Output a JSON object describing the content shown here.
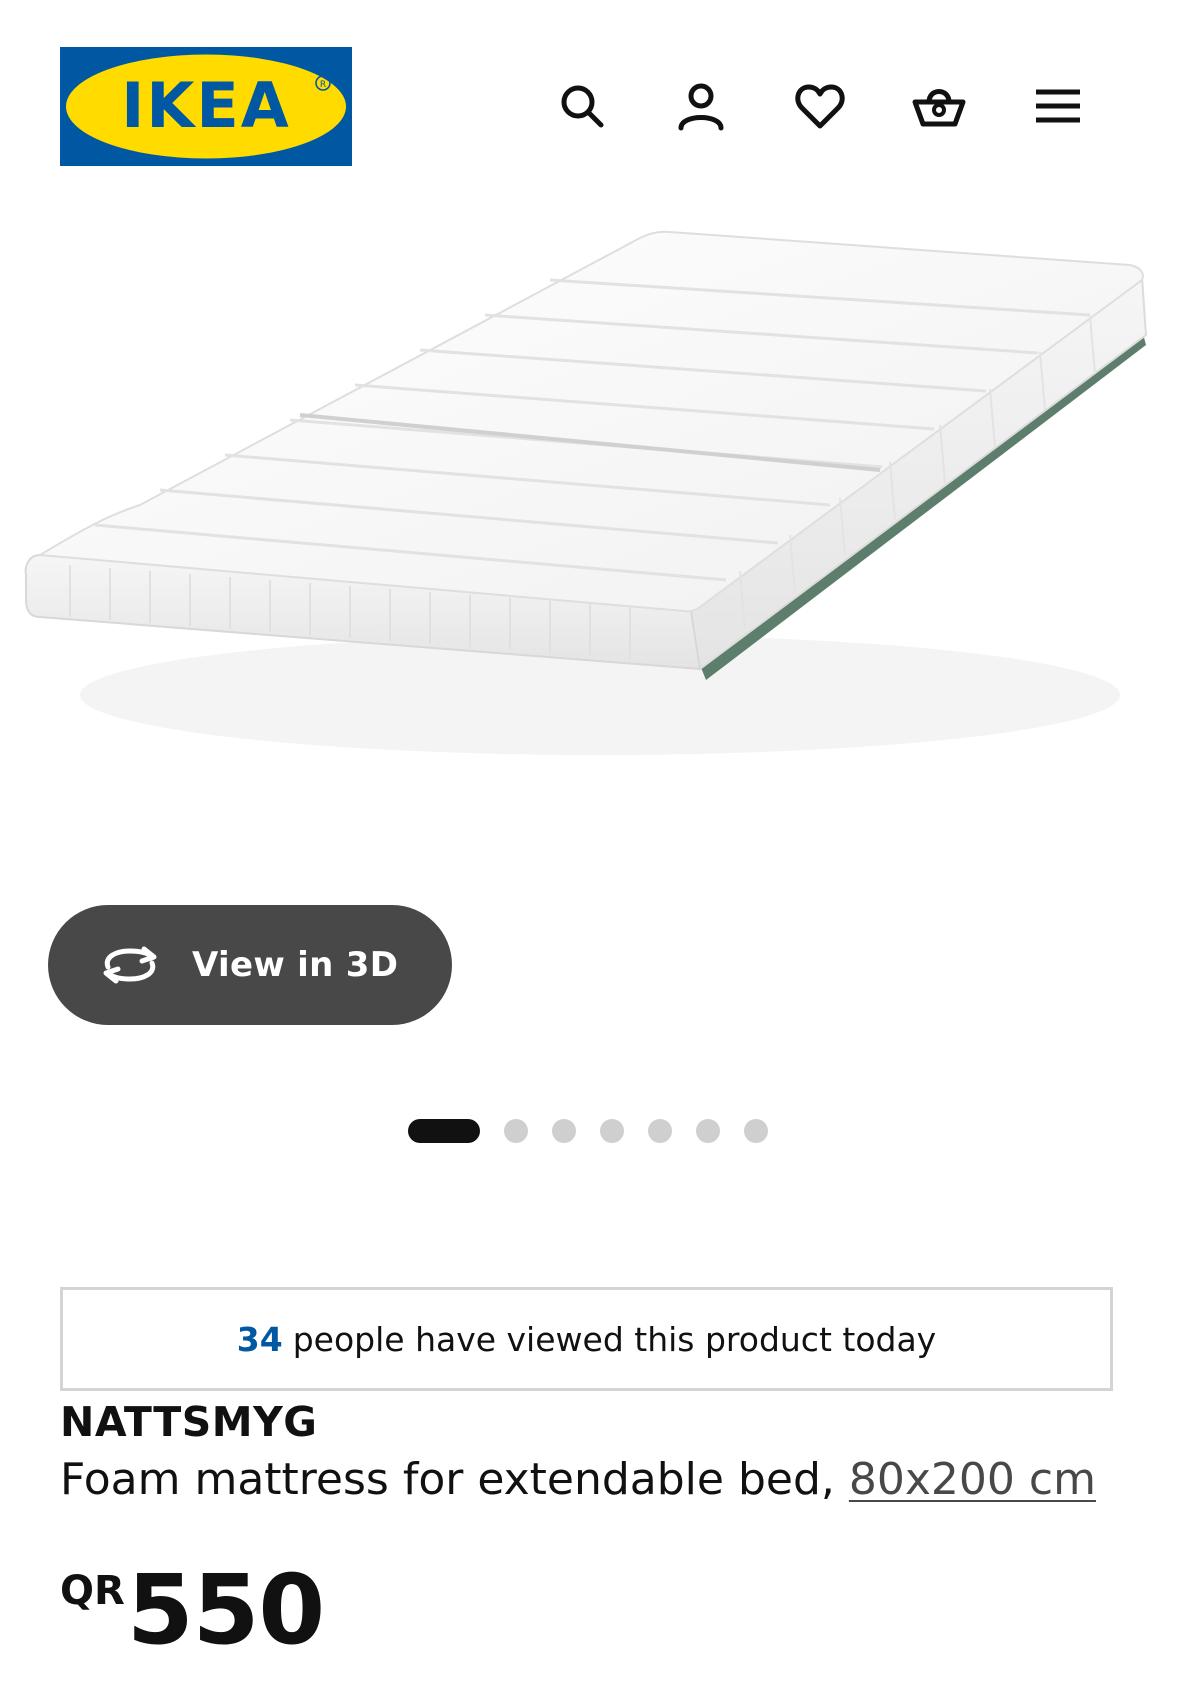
{
  "header": {
    "logo_text": "IKEA",
    "icons": [
      "search-icon",
      "account-icon",
      "heart-icon",
      "basket-icon",
      "menu-icon"
    ]
  },
  "gallery": {
    "view3d_label": "View in 3D",
    "slide_count": 7,
    "active_slide": 1
  },
  "viewed_banner": {
    "count": "34",
    "text": "people have viewed this product today"
  },
  "product": {
    "name": "NATTSMYG",
    "description": "Foam mattress for extendable bed,",
    "size_link": "80x200 cm",
    "price_currency": "QR",
    "price_amount": "550"
  },
  "colors": {
    "brand_blue": "#0058a3",
    "brand_yellow": "#ffdb00",
    "button_dark": "#484848"
  }
}
